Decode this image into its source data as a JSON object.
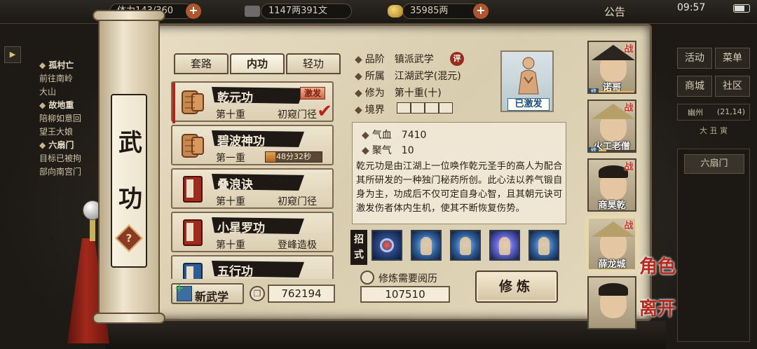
{
  "top": {
    "stamina": "体力143/360",
    "coins": "1147两391文",
    "gold": "35985两",
    "notice": "公告",
    "time": "09:57"
  },
  "quests": [
    {
      "title": "孤村亡",
      "lines": [
        "前往南岭",
        "大山"
      ]
    },
    {
      "title": "故地重",
      "lines": [
        "陪柳如意回",
        "望王大娘"
      ]
    },
    {
      "title": "六扇门",
      "lines": [
        "目标已被拘",
        "部向南宫门"
      ]
    }
  ],
  "right_panel": {
    "buttons": [
      "活动",
      "菜单",
      "商城",
      "社区"
    ],
    "location": "幽州",
    "coords": "(21,14)",
    "subtitle": "大 丑 寅",
    "list_item": "六扇门"
  },
  "scroll": {
    "title_chars": [
      "武",
      "功"
    ],
    "help": "?"
  },
  "tabs": [
    "套路",
    "内功",
    "轻功"
  ],
  "active_tab": 1,
  "skills": [
    {
      "name": "乾元功",
      "level": "第十重",
      "state": "初窥门径",
      "badge": "激发",
      "selected": true
    },
    {
      "name": "碧波神功",
      "level": "第一重",
      "timer": "48分32秒",
      "progress": 0.18
    },
    {
      "name": "叠浪诀",
      "level": "第十重",
      "state": "初窥门径"
    },
    {
      "name": "小星罗功",
      "level": "第十重",
      "state": "登峰造极"
    },
    {
      "name": "五行功",
      "level": "",
      "state": ""
    }
  ],
  "new_skill_label": "新武学",
  "points": "762194",
  "detail": {
    "grade_label": "品阶",
    "grade": "镇派武学",
    "rate_badge": "评",
    "belong_label": "所属",
    "belong": "江湖武学(混元)",
    "cultivation_label": "修为",
    "cultivation": "第十重(十)",
    "realm_label": "境界",
    "realm_cells": 4,
    "portrait_tag": "已激发",
    "stats": [
      {
        "label": "气血",
        "value": "7410"
      },
      {
        "label": "聚气",
        "value": "10"
      }
    ],
    "description": "乾元功是由江湖上一位唤作乾元圣手的高人为配合其所研发的一种独门秘药所创。此心法以养气锻自身为主，功成后不仅可定自身心智，且其朝元诀可激发伤者体内生机，使其不断恢复伤势。",
    "moves_label": "招式",
    "moves": [
      "vortex-move-icon",
      "meditation-move-icon",
      "stance-move-icon",
      "lightning-move-icon",
      "palm-move-icon"
    ],
    "cost_label": "修炼需要阅历",
    "cost": "107510",
    "train_button": "修炼"
  },
  "characters": [
    {
      "name": "诺哥",
      "tag": "战",
      "progress": 0.95
    },
    {
      "name": "火工老僧",
      "tag": "战",
      "progress": 0.2
    },
    {
      "name": "商昊乾",
      "tag": "战",
      "progress": 0.0
    },
    {
      "name": "薛龙城",
      "tag": "战",
      "progress": 0.0,
      "selected": true
    },
    {
      "name": "",
      "tag": "",
      "progress": 0.0
    }
  ],
  "side_actions": {
    "role": "角色",
    "leave": "离开"
  },
  "colors": {
    "accent_red": "#b5231a",
    "parchment": "#e3d8bd",
    "ink": "#2a2017"
  }
}
